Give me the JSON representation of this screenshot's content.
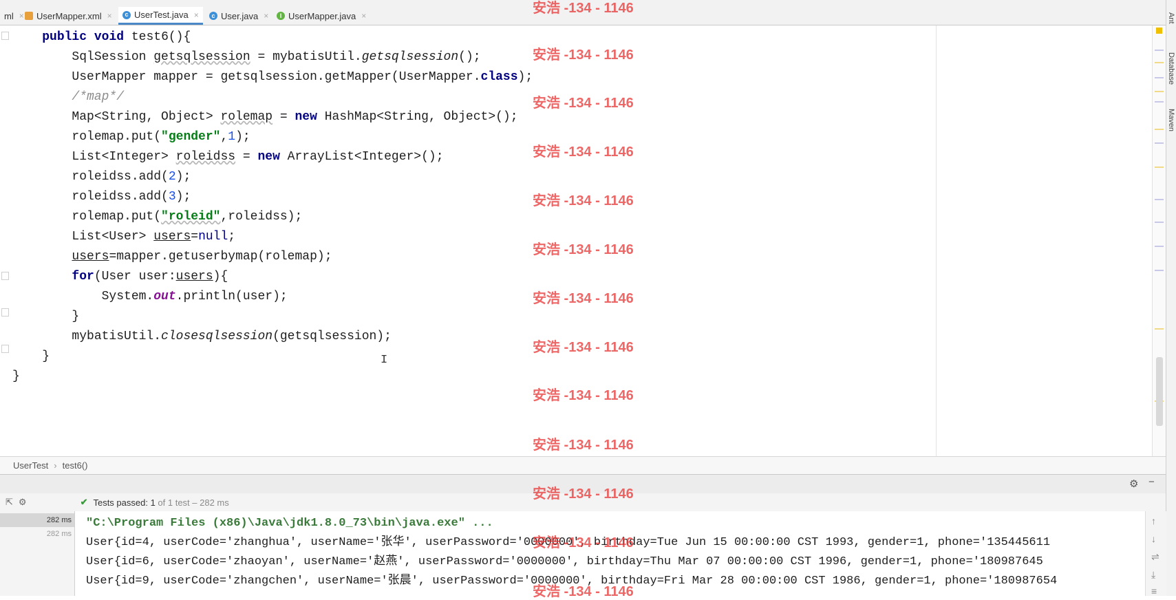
{
  "tabs": [
    {
      "label": "ml",
      "icon": "none"
    },
    {
      "label": "UserMapper.xml",
      "icon": "xml-file-icon"
    },
    {
      "label": "UserTest.java",
      "icon": "class-file-icon",
      "active": true
    },
    {
      "label": "User.java",
      "icon": "class-file-icon"
    },
    {
      "label": "UserMapper.java",
      "icon": "interface-file-icon"
    }
  ],
  "tab_close_glyph": "×",
  "watermark": "安浩 -134 - 1146",
  "breadcrumb": {
    "class": "UserTest",
    "method": "test6()"
  },
  "tests": {
    "status_text": "Tests passed: ",
    "count": "1",
    "detail": " of 1 test – 282 ms"
  },
  "tree": {
    "row1": "282 ms",
    "row2": "282 ms"
  },
  "console": {
    "command": "\"C:\\Program Files (x86)\\Java\\jdk1.8.0_73\\bin\\java.exe\" ...",
    "lines": [
      "User{id=4, userCode='zhanghua', userName='张华', userPassword='0000000', birthday=Tue Jun 15 00:00:00 CST 1993, gender=1, phone='135445611",
      "User{id=6, userCode='zhaoyan', userName='赵燕', userPassword='0000000', birthday=Thu Mar 07 00:00:00 CST 1996, gender=1, phone='180987645",
      "User{id=9, userCode='zhangchen', userName='张晨', userPassword='0000000', birthday=Fri Mar 28 00:00:00 CST 1986, gender=1, phone='180987654"
    ]
  },
  "tool_windows": [
    "Ant",
    "Database",
    "Maven"
  ]
}
